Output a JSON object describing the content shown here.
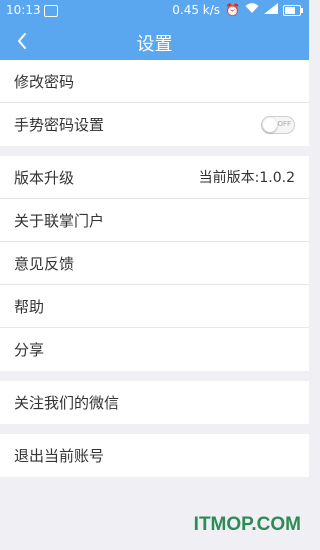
{
  "status_bar": {
    "time": "10:13",
    "speed": "0.45 k/s"
  },
  "header": {
    "title": "设置"
  },
  "group1": [
    {
      "label": "修改密码"
    },
    {
      "label": "手势密码设置",
      "toggle_text": "OFF"
    }
  ],
  "group2": [
    {
      "label": "版本升级",
      "value": "当前版本:1.0.2"
    },
    {
      "label": "关于联掌门户"
    },
    {
      "label": "意见反馈"
    },
    {
      "label": "帮助"
    },
    {
      "label": "分享"
    }
  ],
  "group3": [
    {
      "label": "关注我们的微信"
    }
  ],
  "group4": [
    {
      "label": "退出当前账号"
    }
  ],
  "watermark": "ITMOP.COM",
  "colors": {
    "header_bg": "#5aa7ef",
    "page_bg": "#efeff4",
    "watermark": "#2e8b57"
  }
}
